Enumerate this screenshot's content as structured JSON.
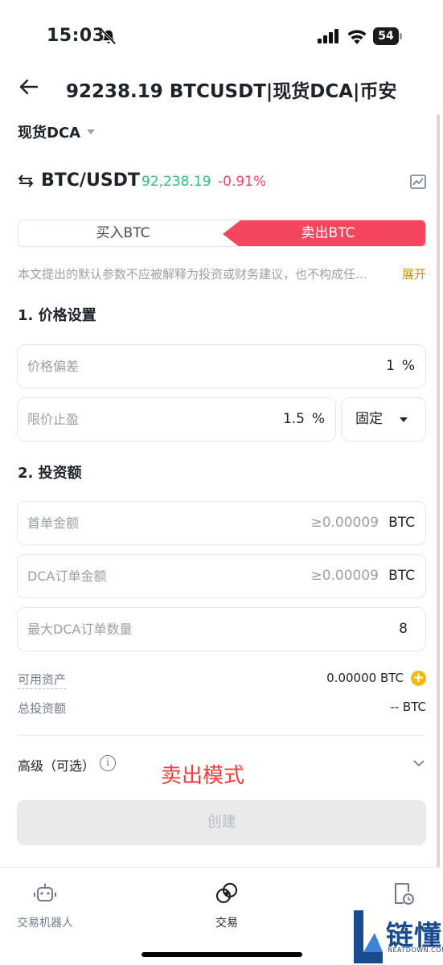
{
  "status_bar": {
    "time": "15:03",
    "battery": "54"
  },
  "header": {
    "title": "92238.19 BTCUSDT|现货DCA|币安"
  },
  "mode": {
    "label": "现货DCA"
  },
  "pair": {
    "name": "BTC/USDT",
    "price": "92,238.19",
    "change": "-0.91%",
    "price_color": "#2ebd85",
    "change_color": "#f6465d"
  },
  "side_toggle": {
    "buy_label": "买入BTC",
    "sell_label": "卖出BTC",
    "active": "sell",
    "sell_color": "#f6465d"
  },
  "disclaimer": {
    "text": "本文提出的默认参数不应被解释为投资或财务建议，也不构成任…",
    "expand_label": "展开"
  },
  "price_settings": {
    "title": "1. 价格设置",
    "price_deviation": {
      "label": "价格偏差",
      "value": "1",
      "unit": "%"
    },
    "take_profit": {
      "label": "限价止盈",
      "value": "1.5",
      "unit": "%"
    },
    "take_profit_mode": {
      "selected": "固定"
    }
  },
  "investment": {
    "title": "2. 投资额",
    "first_order": {
      "label": "首单金额",
      "placeholder": "≥0.00009",
      "unit": "BTC"
    },
    "dca_order": {
      "label": "DCA订单金额",
      "placeholder": "≥0.00009",
      "unit": "BTC"
    },
    "max_dca_orders": {
      "label": "最大DCA订单数量",
      "value": "8"
    }
  },
  "summary": {
    "available_label": "可用资产",
    "available_value": "0.00000 BTC",
    "total_label": "总投资额",
    "total_value": "-- BTC"
  },
  "advanced": {
    "label": "高级（可选）",
    "annotation": "卖出模式"
  },
  "create_button": {
    "label": "创建"
  },
  "bottom_nav": {
    "items": [
      {
        "label": "交易机器人",
        "icon": "robot-icon"
      },
      {
        "label": "交易",
        "icon": "trade-icon"
      },
      {
        "label": "",
        "icon": "history-icon"
      }
    ]
  },
  "watermark": {
    "big": "链懂",
    "small": "NEATDOWN.COM"
  },
  "colors": {
    "accent_yellow": "#f0b90b",
    "expand_link": "#c99400",
    "annotation_red": "#f03c3c"
  }
}
